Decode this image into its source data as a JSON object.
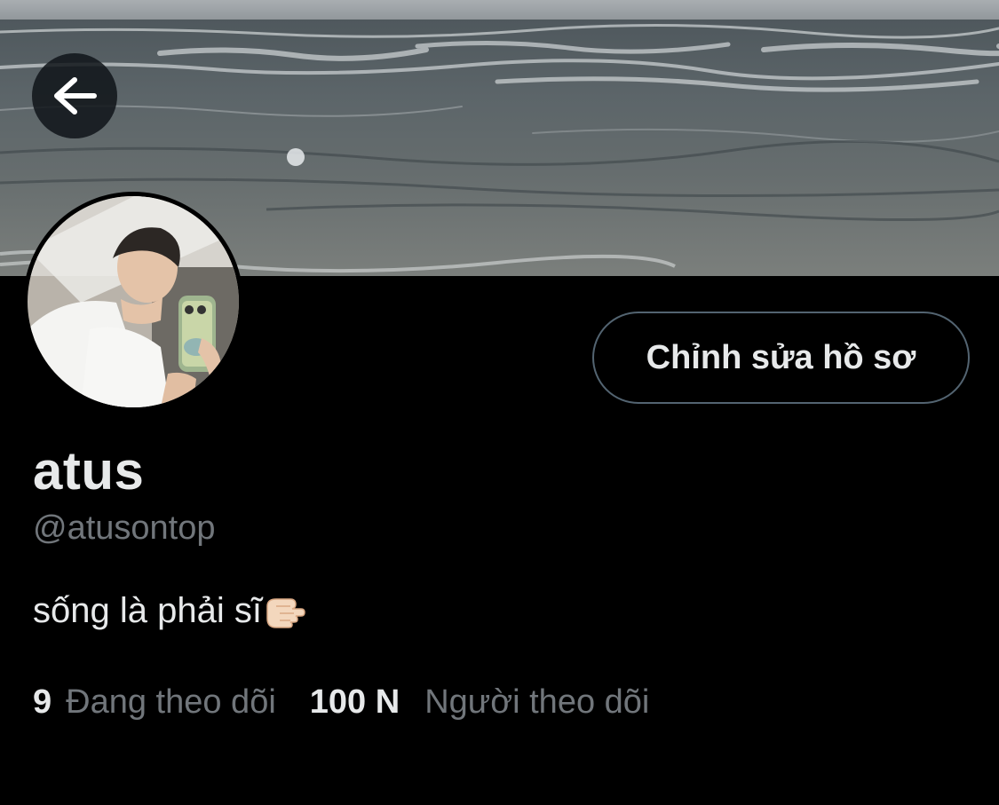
{
  "profile": {
    "display_name": "atus",
    "handle": "@atusontop",
    "bio": "sống là phải sĩ",
    "bio_emoji": "pointing-hand-emoji"
  },
  "actions": {
    "edit_profile_label": "Chỉnh sửa hồ sơ"
  },
  "stats": {
    "following_count": "9",
    "following_label": "Đang theo dõi",
    "followers_count": "100 N",
    "followers_label": "Người theo dõi"
  },
  "header": {
    "back_icon": "arrow-left-icon",
    "banner_image": "ocean-waves-banner"
  },
  "colors": {
    "background": "#000000",
    "primary_text": "#e7e9ea",
    "secondary_text": "#71767b",
    "button_border": "#536471"
  }
}
